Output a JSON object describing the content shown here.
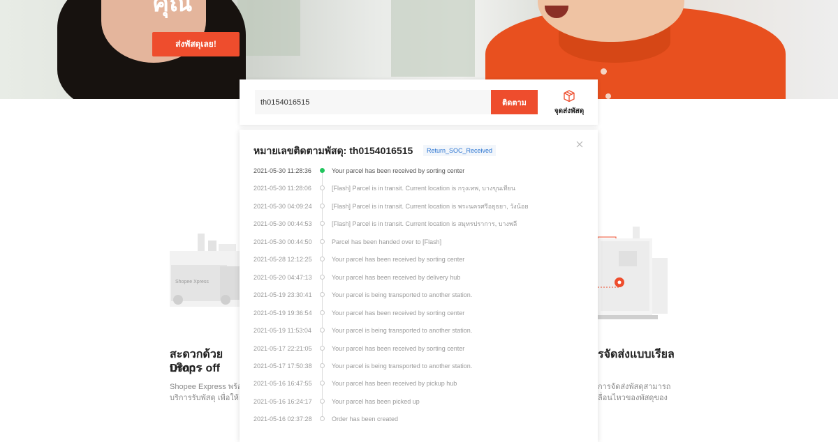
{
  "hero": {
    "heading": "คุณ",
    "cta_label": "ส่งพัสดุเลย!"
  },
  "search": {
    "tracking_number": "th0154016515",
    "track_button": "ติดตาม",
    "dropoff_label": "จุดส่งพัสดุ",
    "dropoff_icon": "parcel-box-icon"
  },
  "tracking": {
    "title_prefix": "หมายเลขติดตามพัสดุ: th0154016515",
    "status_badge": "Return_SOC_Received",
    "close_icon": "close-icon",
    "events": [
      {
        "time": "2021-05-30 11:28:36",
        "desc": "Your parcel has been received by sorting center"
      },
      {
        "time": "2021-05-30 11:28:06",
        "desc": "[Flash] Parcel is in transit. Current location is กรุงเทพ, บางขุนเทียน"
      },
      {
        "time": "2021-05-30 04:09:24",
        "desc": "[Flash] Parcel is in transit. Current location is พระนครศรีอยุธยา, วังน้อย"
      },
      {
        "time": "2021-05-30 00:44:53",
        "desc": "[Flash] Parcel is in transit. Current location is สมุทรปราการ, บางพลี"
      },
      {
        "time": "2021-05-30 00:44:50",
        "desc": "Parcel has been handed over to [Flash]"
      },
      {
        "time": "2021-05-28 12:12:25",
        "desc": "Your parcel has been received by sorting center"
      },
      {
        "time": "2021-05-20 04:47:13",
        "desc": "Your parcel has been received by delivery hub"
      },
      {
        "time": "2021-05-19 23:30:41",
        "desc": "Your parcel is being transported to another station."
      },
      {
        "time": "2021-05-19 19:36:54",
        "desc": "Your parcel has been received by sorting center"
      },
      {
        "time": "2021-05-19 11:53:04",
        "desc": "Your parcel is being transported to another station."
      },
      {
        "time": "2021-05-17 22:21:05",
        "desc": "Your parcel has been received by sorting center"
      },
      {
        "time": "2021-05-17 17:50:38",
        "desc": "Your parcel is being transported to another station."
      },
      {
        "time": "2021-05-16 16:47:55",
        "desc": "Your parcel has been received by pickup hub"
      },
      {
        "time": "2021-05-16 16:24:17",
        "desc": "Your parcel has been picked up"
      },
      {
        "time": "2021-05-16 02:37:28",
        "desc": "Order has been created"
      }
    ]
  },
  "features": {
    "left_title_line1": "สะดวกด้วยบริการ",
    "left_title_line2": "Drop - off",
    "left_text_line1": "Shopee Express พร้อม",
    "left_text_line2": "บริการรับพัสดุ เพื่อให้การ",
    "right_title": "รจัดส่งแบบเรียล",
    "right_text_line1": "การจัดส่งพัสดุสามารถ",
    "right_text_line2": "ลื่อนไหวของพัสดุของ",
    "truck_brand": "Shopee Xpress"
  },
  "colors": {
    "accent": "#ee4d2d",
    "current_dot": "#22c55e",
    "badge_text": "#2a74d1"
  }
}
